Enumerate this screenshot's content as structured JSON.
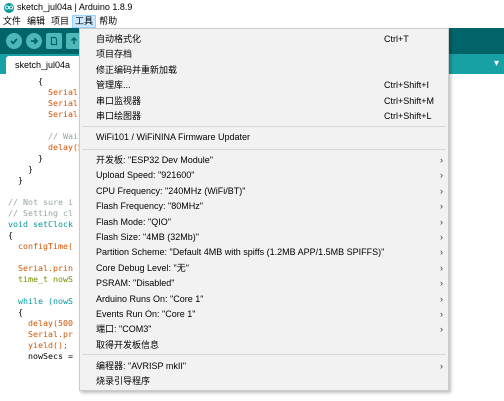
{
  "window": {
    "title": "sketch_jul04a | Arduino 1.8.9"
  },
  "menubar": {
    "items": [
      "文件",
      "编辑",
      "项目",
      "工具",
      "帮助"
    ]
  },
  "tabs": [
    "sketch_jul04a"
  ],
  "editor": {
    "lines": [
      "      {",
      "        Serial.",
      "        Serial.",
      "        Serial.",
      "",
      "        // Wait",
      "        delay(5",
      "      }",
      "    }",
      "  }",
      "",
      "// Not sure i",
      "// Setting cl",
      "void setClock",
      "{",
      "  configTime(",
      "",
      "  Serial.prin",
      "  time_t nowS",
      "",
      "  while (nowS",
      "  {",
      "    delay(500",
      "    Serial.pr",
      "    yield();",
      "    nowSecs ="
    ]
  },
  "tools_menu": {
    "group1": [
      {
        "label": "自动格式化",
        "shortcut": "Ctrl+T"
      },
      {
        "label": "项目存档",
        "shortcut": ""
      },
      {
        "label": "修正编码并重新加载",
        "shortcut": ""
      },
      {
        "label": "管理库...",
        "shortcut": "Ctrl+Shift+I"
      },
      {
        "label": "串口监视器",
        "shortcut": "Ctrl+Shift+M"
      },
      {
        "label": "串口绘图器",
        "shortcut": "Ctrl+Shift+L"
      }
    ],
    "group2": [
      {
        "label": "WiFi101 / WiFiNINA Firmware Updater"
      }
    ],
    "group3": [
      {
        "label": "开发板: \"ESP32 Dev Module\""
      },
      {
        "label": "Upload Speed: \"921600\""
      },
      {
        "label": "CPU Frequency: \"240MHz (WiFi/BT)\""
      },
      {
        "label": "Flash Frequency: \"80MHz\""
      },
      {
        "label": "Flash Mode: \"QIO\""
      },
      {
        "label": "Flash Size: \"4MB (32Mb)\""
      },
      {
        "label": "Partition Scheme: \"Default 4MB with spiffs (1.2MB APP/1.5MB SPIFFS)\""
      },
      {
        "label": "Core Debug Level: \"无\""
      },
      {
        "label": "PSRAM: \"Disabled\""
      },
      {
        "label": "Arduino Runs On: \"Core 1\""
      },
      {
        "label": "Events Run On: \"Core 1\""
      },
      {
        "label": "端口: \"COM3\""
      },
      {
        "label": "取得开发板信息"
      }
    ],
    "group4": [
      {
        "label": "编程器: \"AVRISP mkII\""
      },
      {
        "label": "烧录引导程序"
      }
    ]
  },
  "colors": {
    "toolbar": "#006468",
    "tab_row": "#17a1a5",
    "accent": "#00979c"
  }
}
